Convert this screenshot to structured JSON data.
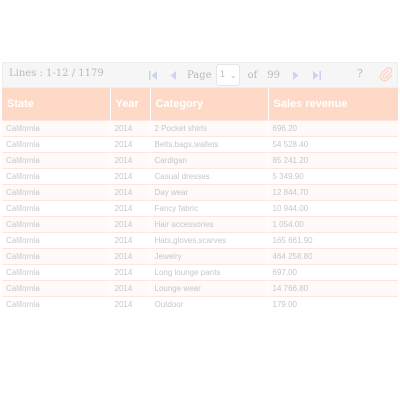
{
  "toolbar": {
    "lines_info": "Lines : 1-12 / 1179",
    "page_label": "Page",
    "page_value": "1",
    "of_label": "of",
    "total_pages": "99",
    "help_label": "?"
  },
  "icons": {
    "first": "first-page-icon",
    "prev": "previous-page-icon",
    "next": "next-page-icon",
    "last": "last-page-icon",
    "export": "paperclip-icon"
  },
  "colors": {
    "header_bg": "#ffd9c7",
    "nav_icons": "#cdd5ee"
  },
  "table": {
    "columns": [
      "State",
      "Year",
      "Category",
      "Sales revenue"
    ],
    "rows": [
      [
        "California",
        "2014",
        "2 Pocket shirts",
        "696.20"
      ],
      [
        "California",
        "2014",
        "Belts,bags,wallets",
        "54 528.40"
      ],
      [
        "California",
        "2014",
        "Cardigan",
        "85 241.20"
      ],
      [
        "California",
        "2014",
        "Casual dresses",
        "5 349.90"
      ],
      [
        "California",
        "2014",
        "Day wear",
        "12 844.70"
      ],
      [
        "California",
        "2014",
        "Fancy fabric",
        "10 944.00"
      ],
      [
        "California",
        "2014",
        "Hair accessories",
        "1 054.00"
      ],
      [
        "California",
        "2014",
        "Hats,gloves,scarves",
        "165 661.90"
      ],
      [
        "California",
        "2014",
        "Jewelry",
        "464 258.80"
      ],
      [
        "California",
        "2014",
        "Long lounge pants",
        "697.00"
      ],
      [
        "California",
        "2014",
        "Lounge wear",
        "14 766.80"
      ],
      [
        "California",
        "2014",
        "Outdoor",
        "179.00"
      ]
    ]
  }
}
